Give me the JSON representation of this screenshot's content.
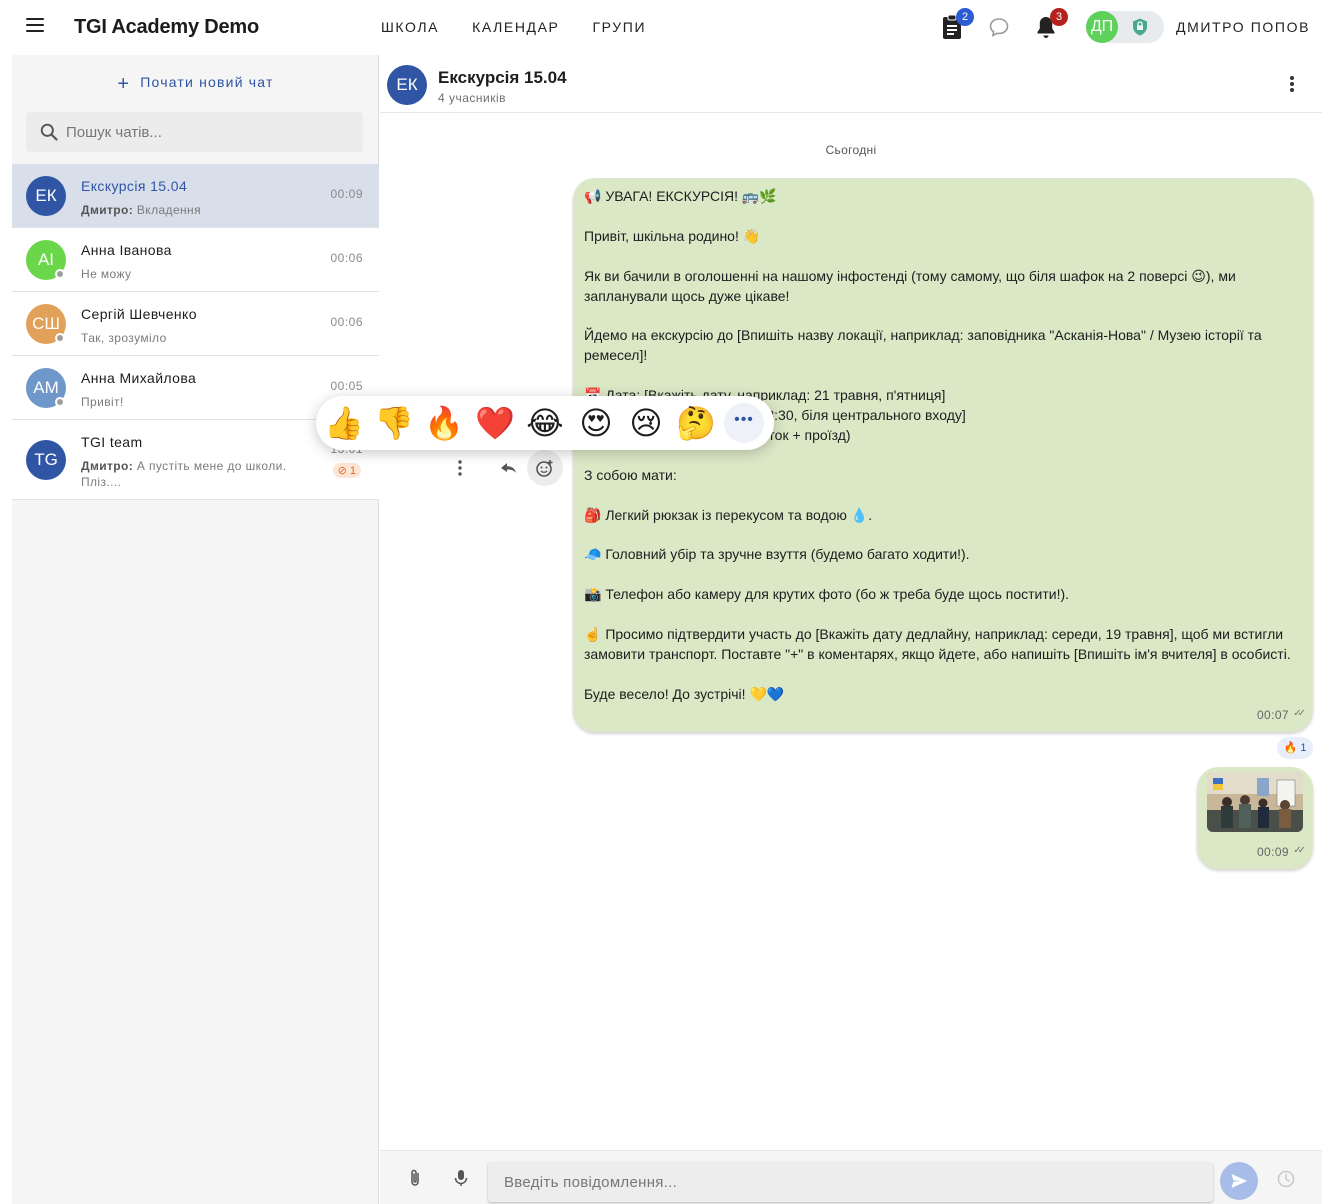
{
  "app": {
    "title": "TGI Academy Demo",
    "nav": [
      "ШКОЛА",
      "КАЛЕНДАР",
      "ГРУПИ"
    ],
    "assignments_badge": "2",
    "notifications_badge": "3",
    "user_initials": "ДП",
    "user_name": "ДМИТРО ПОПОВ",
    "icons": [
      "menu-icon",
      "clipboard-icon",
      "chat-bubble-icon",
      "bell-icon",
      "shield-icon"
    ]
  },
  "sidebar": {
    "new_chat": "Почати новий чат",
    "search_placeholder": "Пошук чатів...",
    "chats": [
      {
        "initials": "ЕК",
        "name": "Екскурсія 15.04",
        "sender": "Дмитро:",
        "preview": " Вкладення",
        "time": "00:09",
        "color": "#2f55a4",
        "active": true
      },
      {
        "initials": "АІ",
        "name": "Анна Іванова",
        "preview": "Не можу",
        "time": "00:06",
        "color": "#6ad64a"
      },
      {
        "initials": "СШ",
        "name": "Сергій Шевченко",
        "preview": "Так, зрозуміло",
        "time": "00:06",
        "color": "#e2a158"
      },
      {
        "initials": "АМ",
        "name": "Анна Михайлова",
        "preview": "Привіт!",
        "time": "00:05",
        "color": "#6f97c9"
      },
      {
        "initials": "TG",
        "name": "TGI team",
        "sender": "Дмитро:",
        "preview": " А пустіть мене до школи. Пліз....",
        "time": "13:01",
        "unread": "⊘ 1",
        "color": "#2f55a4"
      }
    ]
  },
  "chat": {
    "initials": "ЕК",
    "title": "Екскурсія 15.04",
    "subtitle": "4 учасників",
    "day_label": "Сьогодні",
    "message_text": "📢 УВАГА! ЕКСКУРСІЯ! 🚌🌿\n\nПривіт, шкільна родино! 👋\n\nЯк ви бачили в оголошенні на нашому інфостенді (тому самому, що біля шафок на 2 поверсі 😉), ми запланували щось дуже цікаве!\n\nЙдемо на екскурсію до [Впишіть назву локації, наприклад: заповідника \"Асканія-Нова\" / Музею історії та ремесел]!\n\n📅 Дата: [Вкажіть дату, наприклад: 21 травня, п'ятниця]\n⏰ Час збору: [наприклад: 08:30, біля центрального входу]\n💰 Вартість: [Сума] грн. (квиток + проїзд)\n\nЗ собою мати:\n\n🎒 Легкий рюкзак із перекусом та водою 💧.\n\n🧢 Головний убір та зручне взуття (будемо багато ходити!).\n\n📸 Телефон або камеру для крутих фото (бо ж треба буде щось постити!).\n\n☝️ Просимо підтвердити участь до [Вкажіть дату дедлайну, наприклад: середи, 19 травня], щоб ми встигли замовити транспорт. Поставте \"+\" в коментарях, якщо йдете, або напишіть [Впишіть ім'я вчителя] в особисті.\n\nБуде весело! До зустрічі! 💛💙",
    "message_time": "00:07",
    "reaction": "🔥 1",
    "image_time": "00:09",
    "picker_emojis": [
      "👍",
      "👎",
      "🔥",
      "❤️",
      "😂",
      "😍",
      "😢",
      "🤔"
    ],
    "picker_more": "•••",
    "composer_placeholder": "Введіть повідомлення..."
  },
  "colors": {
    "accent": "#2f55a4",
    "bubble": "#dbe8c6",
    "active_chat": "#d8dfea"
  }
}
